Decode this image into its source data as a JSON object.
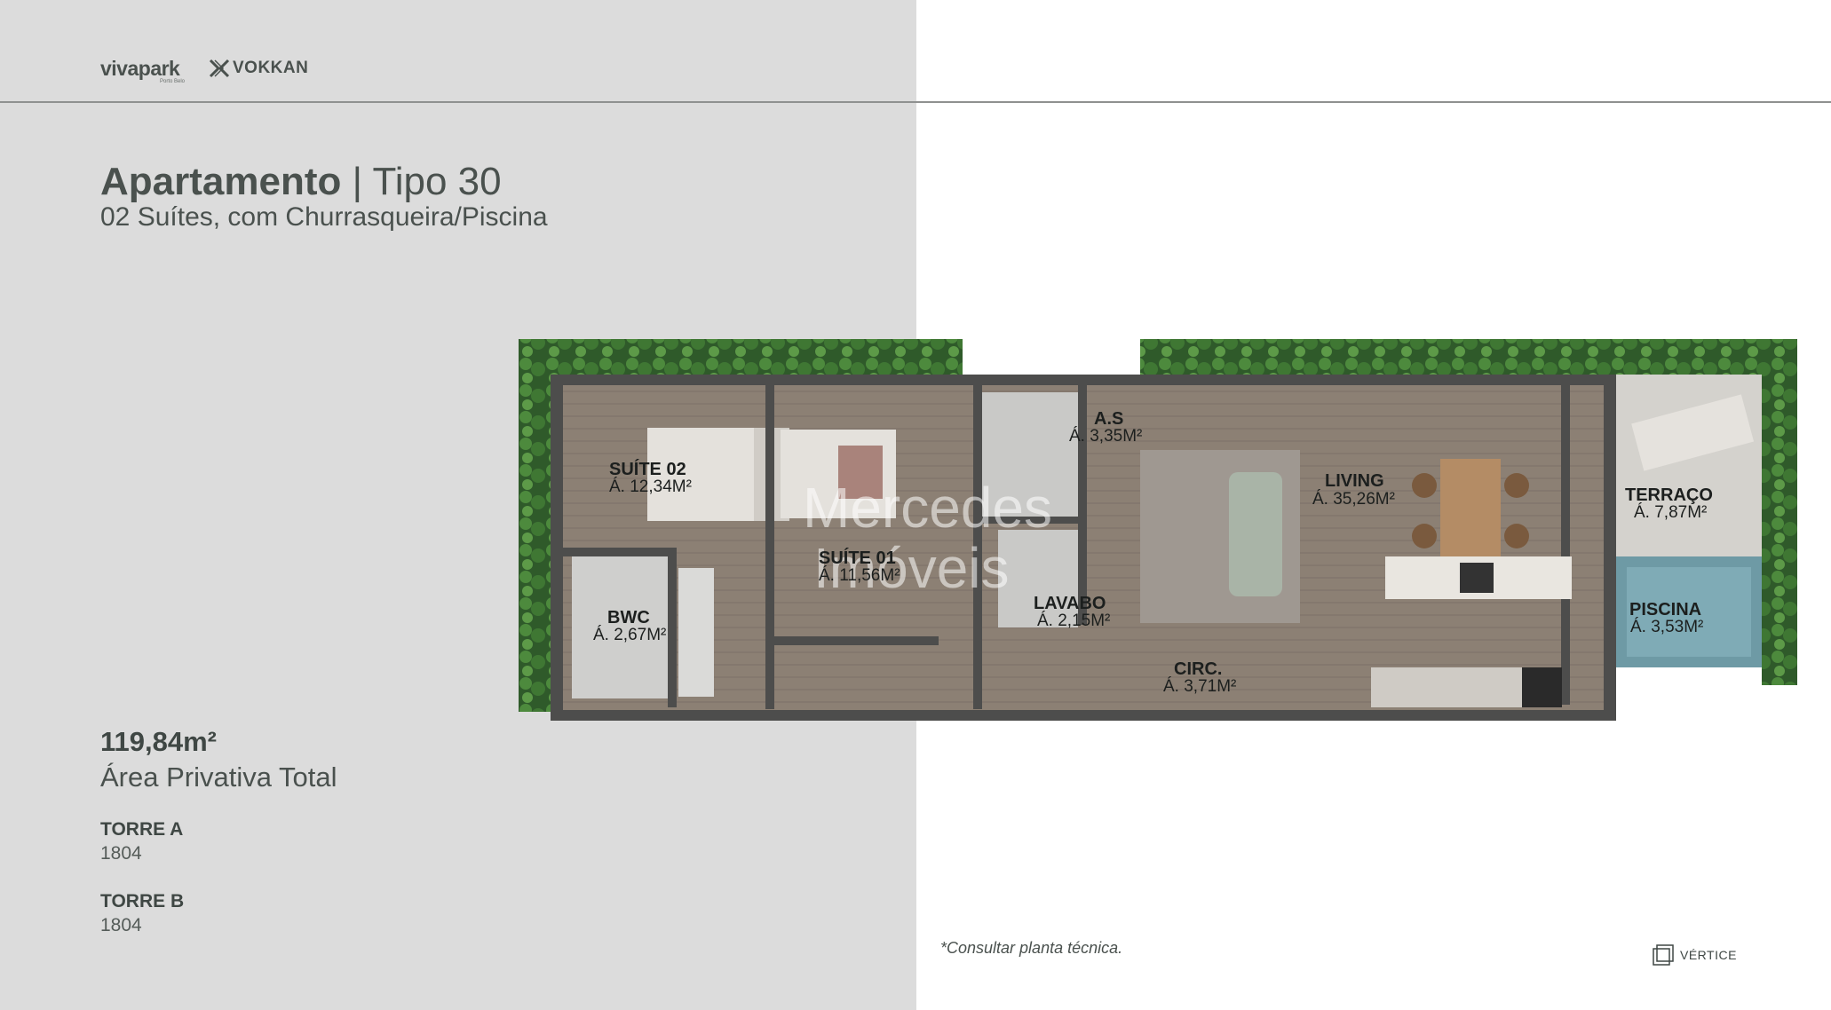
{
  "brand": {
    "vivapark": "vivapark",
    "vivapark_sub": "Porto Belo",
    "vokkan": "VOKKAN",
    "vertice": "VÉRTICE"
  },
  "heading": {
    "title_bold": "Apartamento",
    "title_sep": " | ",
    "title_type": "Tipo 30",
    "subtitle": "02 Suítes, com Churrasqueira/Piscina"
  },
  "area": {
    "value": "119,84m²",
    "label": "Área Privativa Total"
  },
  "towers": [
    {
      "name": "TORRE A",
      "unit": "1804"
    },
    {
      "name": "TORRE B",
      "unit": "1804"
    }
  ],
  "footnote": "*Consultar planta técnica.",
  "watermark": {
    "line1": "Mercedes",
    "line2": "Imóveis"
  },
  "rooms": {
    "suite02": {
      "name": "SUÍTE 02",
      "area": "Á. 12,34M²"
    },
    "suite01": {
      "name": "SUÍTE 01",
      "area": "Á. 11,56M²"
    },
    "as": {
      "name": "A.S",
      "area": "Á. 3,35M²"
    },
    "living": {
      "name": "LIVING",
      "area": "Á. 35,26M²"
    },
    "terraco": {
      "name": "TERRAÇO",
      "area": "Á. 7,87M²"
    },
    "bwc": {
      "name": "BWC",
      "area": "Á. 2,67M²"
    },
    "lavabo": {
      "name": "LAVABO",
      "area": "Á. 2,15M²"
    },
    "circ": {
      "name": "CIRC.",
      "area": "Á. 3,71M²"
    },
    "piscina": {
      "name": "PISCINA",
      "area": "Á. 3,53M²"
    }
  },
  "colors": {
    "panel": "#dcdcdc",
    "text": "#4a514e",
    "floor": "#8c8074",
    "wall": "#4d4d4c",
    "planter": "#3d6b35",
    "pool": "#6e9aa5"
  }
}
